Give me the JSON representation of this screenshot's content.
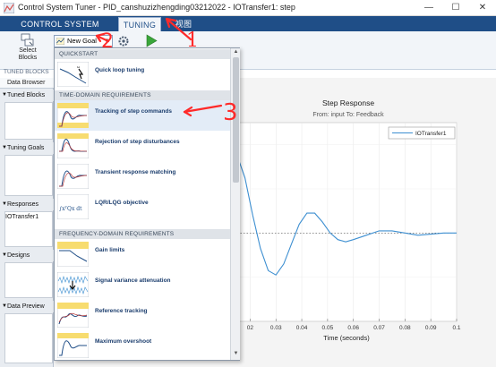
{
  "window": {
    "title": "Control System Tuner - PID_canshuzizhengding03212022 - IOTransfer1: step",
    "minimize_glyph": "—",
    "maximize_glyph": "☐",
    "close_glyph": "✕"
  },
  "tabs": [
    {
      "label": "CONTROL SYSTEM"
    },
    {
      "label": "TUNING"
    },
    {
      "label": "视图"
    }
  ],
  "toolstrip": {
    "select_blocks_label_1": "Select",
    "select_blocks_label_2": "Blocks",
    "tuned_blocks_caption": "TUNED BLOCKS",
    "new_goal_label": "New Goal",
    "new_goal_arrow": "▼"
  },
  "left_panel": {
    "data_browser_tab": "Data Browser",
    "sections": [
      {
        "label": "Tuned Blocks"
      },
      {
        "label": "Tuning Goals"
      },
      {
        "label": "Responses"
      },
      {
        "label": "Designs"
      },
      {
        "label": "Data Preview"
      }
    ],
    "responses_item": "IOTransfer1"
  },
  "dropdown": {
    "headers": [
      {
        "label": "QUICKSTART"
      },
      {
        "label": "TIME-DOMAIN REQUIREMENTS"
      },
      {
        "label": "FREQUENCY-DOMAIN REQUIREMENTS"
      }
    ],
    "items": [
      {
        "label": "Quick loop tuning"
      },
      {
        "label": "Tracking of step commands"
      },
      {
        "label": "Rejection of step disturbances"
      },
      {
        "label": "Transient response matching"
      },
      {
        "label": "LQR/LQG objective"
      },
      {
        "label": "Gain limits"
      },
      {
        "label": "Signal variance attenuation"
      },
      {
        "label": "Reference tracking"
      },
      {
        "label": "Maximum overshoot"
      }
    ],
    "lqr_formula": "∫xᵀQx dt"
  },
  "plot": {
    "title": "Step Response",
    "subtitle": "From: input  To: Feedback",
    "xlabel": "Time (seconds)",
    "legend": "IOTransfer1",
    "xticks": [
      "02",
      "0.03",
      "0.04",
      "0.05",
      "0.06",
      "0.07",
      "0.08",
      "0.09",
      "0.1"
    ]
  },
  "chart_data": {
    "type": "line",
    "title": "Step Response",
    "subtitle": "From: input  To: Feedback",
    "xlabel": "Time (seconds)",
    "ylabel": "",
    "xlim": [
      0.015,
      0.1
    ],
    "ylim": [
      0.6,
      1.5
    ],
    "reference_line": 1.0,
    "series": [
      {
        "name": "IOTransfer1",
        "x": [
          0.015,
          0.018,
          0.021,
          0.024,
          0.027,
          0.03,
          0.033,
          0.036,
          0.039,
          0.042,
          0.045,
          0.048,
          0.051,
          0.054,
          0.057,
          0.06,
          0.065,
          0.07,
          0.075,
          0.08,
          0.085,
          0.09,
          0.095,
          0.1
        ],
        "y": [
          1.35,
          1.25,
          1.08,
          0.93,
          0.83,
          0.81,
          0.86,
          0.95,
          1.04,
          1.09,
          1.09,
          1.05,
          1.0,
          0.97,
          0.96,
          0.97,
          0.99,
          1.01,
          1.01,
          1.0,
          0.99,
          0.995,
          1.0,
          1.0
        ]
      }
    ]
  },
  "annotations": {
    "labels": [
      "1",
      "2",
      "3"
    ],
    "color": "#ff2a2a"
  },
  "colors": {
    "accent": "#1f4e87",
    "curve": "#3d8fd1",
    "annotation": "#ff2a2a"
  }
}
